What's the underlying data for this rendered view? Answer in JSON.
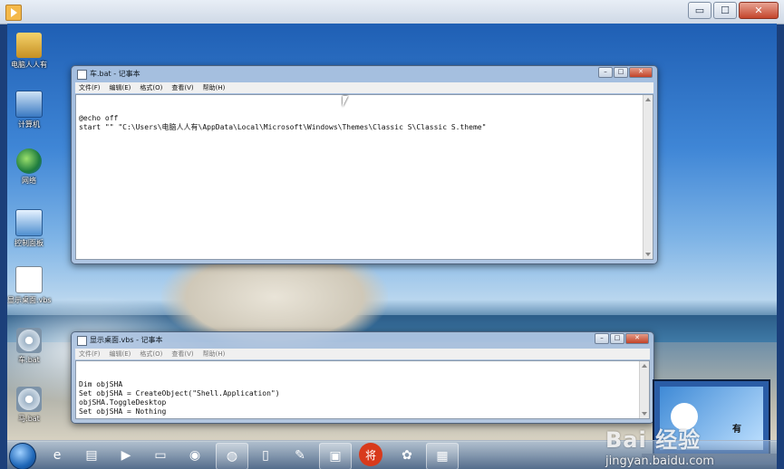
{
  "colors": {
    "taskbar": "#3c5a82",
    "close_button": "#c24328",
    "desktop_sky": "#3f86d6"
  },
  "host_window": {
    "icon": "play-icon",
    "buttons": {
      "minimize": "▭",
      "maximize": "☐",
      "close": "✕"
    }
  },
  "desktop_icons": [
    {
      "label": "电脑人人有",
      "icon": "user-folder-icon"
    },
    {
      "label": "计算机",
      "icon": "computer-icon"
    },
    {
      "label": "网络",
      "icon": "network-icon"
    },
    {
      "label": "控制面板",
      "icon": "control-panel-icon"
    },
    {
      "label": "显示桌面.vbs",
      "icon": "script-file-icon"
    },
    {
      "label": "车.bat",
      "icon": "batch-file-icon"
    },
    {
      "label": "马.bat",
      "icon": "batch-file-icon"
    }
  ],
  "notepad_top": {
    "title": "车.bat - 记事本",
    "menu": [
      "文件(F)",
      "编辑(E)",
      "格式(O)",
      "查看(V)",
      "帮助(H)"
    ],
    "content": "@echo off\nstart \"\" \"C:\\Users\\电脑人人有\\AppData\\Local\\Microsoft\\Windows\\Themes\\Classic S\\Classic S.theme\""
  },
  "notepad_bottom": {
    "title": "显示桌面.vbs - 记事本",
    "menu": [
      "文件(F)",
      "编辑(E)",
      "格式(O)",
      "查看(V)",
      "帮助(H)"
    ],
    "content": "Dim objSHA\nSet objSHA = CreateObject(\"Shell.Application\")\nobjSHA.ToggleDesktop\nSet objSHA = Nothing"
  },
  "window_buttons": {
    "minimize": "–",
    "maximize": "□",
    "close": "✕"
  },
  "taskbar": {
    "items": [
      {
        "name": "ie-icon",
        "glyph": "e"
      },
      {
        "name": "explorer-icon",
        "glyph": "▤"
      },
      {
        "name": "media-player-icon",
        "glyph": "▶"
      },
      {
        "name": "folder-icon",
        "glyph": "▭"
      },
      {
        "name": "chrome-icon",
        "glyph": "◉"
      },
      {
        "name": "app-icon",
        "glyph": "◍"
      },
      {
        "name": "document-icon",
        "glyph": "▯"
      },
      {
        "name": "paint-icon",
        "glyph": "✎"
      },
      {
        "name": "remote-icon",
        "glyph": "▣"
      },
      {
        "name": "chess-icon",
        "glyph": "将"
      },
      {
        "name": "baidu-icon",
        "glyph": "✿"
      },
      {
        "name": "notepad-icon",
        "glyph": "▦"
      }
    ]
  },
  "watermark": {
    "brand": "Bai 经验",
    "url": "jingyan.baidu.com",
    "overlay_text": "有"
  }
}
